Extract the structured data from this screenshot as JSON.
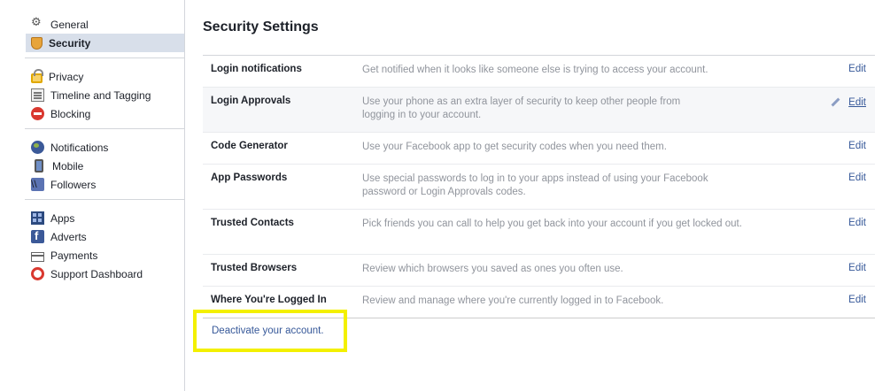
{
  "sidebar": {
    "groups": [
      [
        {
          "label": "General",
          "icon": "gear-icon"
        },
        {
          "label": "Security",
          "icon": "shield-icon",
          "active": true
        }
      ],
      [
        {
          "label": "Privacy",
          "icon": "lock-icon"
        },
        {
          "label": "Timeline and Tagging",
          "icon": "timeline-icon"
        },
        {
          "label": "Blocking",
          "icon": "block-icon"
        }
      ],
      [
        {
          "label": "Notifications",
          "icon": "globe-icon"
        },
        {
          "label": "Mobile",
          "icon": "mobile-icon"
        },
        {
          "label": "Followers",
          "icon": "rss-icon"
        }
      ],
      [
        {
          "label": "Apps",
          "icon": "apps-icon"
        },
        {
          "label": "Adverts",
          "icon": "adverts-icon"
        },
        {
          "label": "Payments",
          "icon": "card-icon"
        },
        {
          "label": "Support Dashboard",
          "icon": "lifebuoy-icon"
        }
      ]
    ]
  },
  "main": {
    "title": "Security Settings",
    "rows": [
      {
        "name": "Login notifications",
        "desc": "Get notified when it looks like someone else is trying to access your account.",
        "edit": "Edit"
      },
      {
        "name": "Login Approvals",
        "desc": "Use your phone as an extra layer of security to keep other people from logging in to your account.",
        "edit": "Edit"
      },
      {
        "name": "Code Generator",
        "desc": "Use your Facebook app to get security codes when you need them.",
        "edit": "Edit"
      },
      {
        "name": "App Passwords",
        "desc": "Use special passwords to log in to your apps instead of using your Facebook password or Login Approvals codes.",
        "edit": "Edit"
      },
      {
        "name": "Trusted Contacts",
        "desc": "Pick friends you can call to help you get back into your account if you get locked out.",
        "edit": "Edit"
      },
      {
        "name": "Trusted Browsers",
        "desc": "Review which browsers you saved as ones you often use.",
        "edit": "Edit"
      },
      {
        "name": "Where You're Logged In",
        "desc": "Review and manage where you're currently logged in to Facebook.",
        "edit": "Edit"
      }
    ],
    "deactivate_label": "Deactivate your account."
  },
  "colors": {
    "link": "#365899",
    "active_bg": "#d8dfea",
    "highlight_box": "#f3f000"
  }
}
